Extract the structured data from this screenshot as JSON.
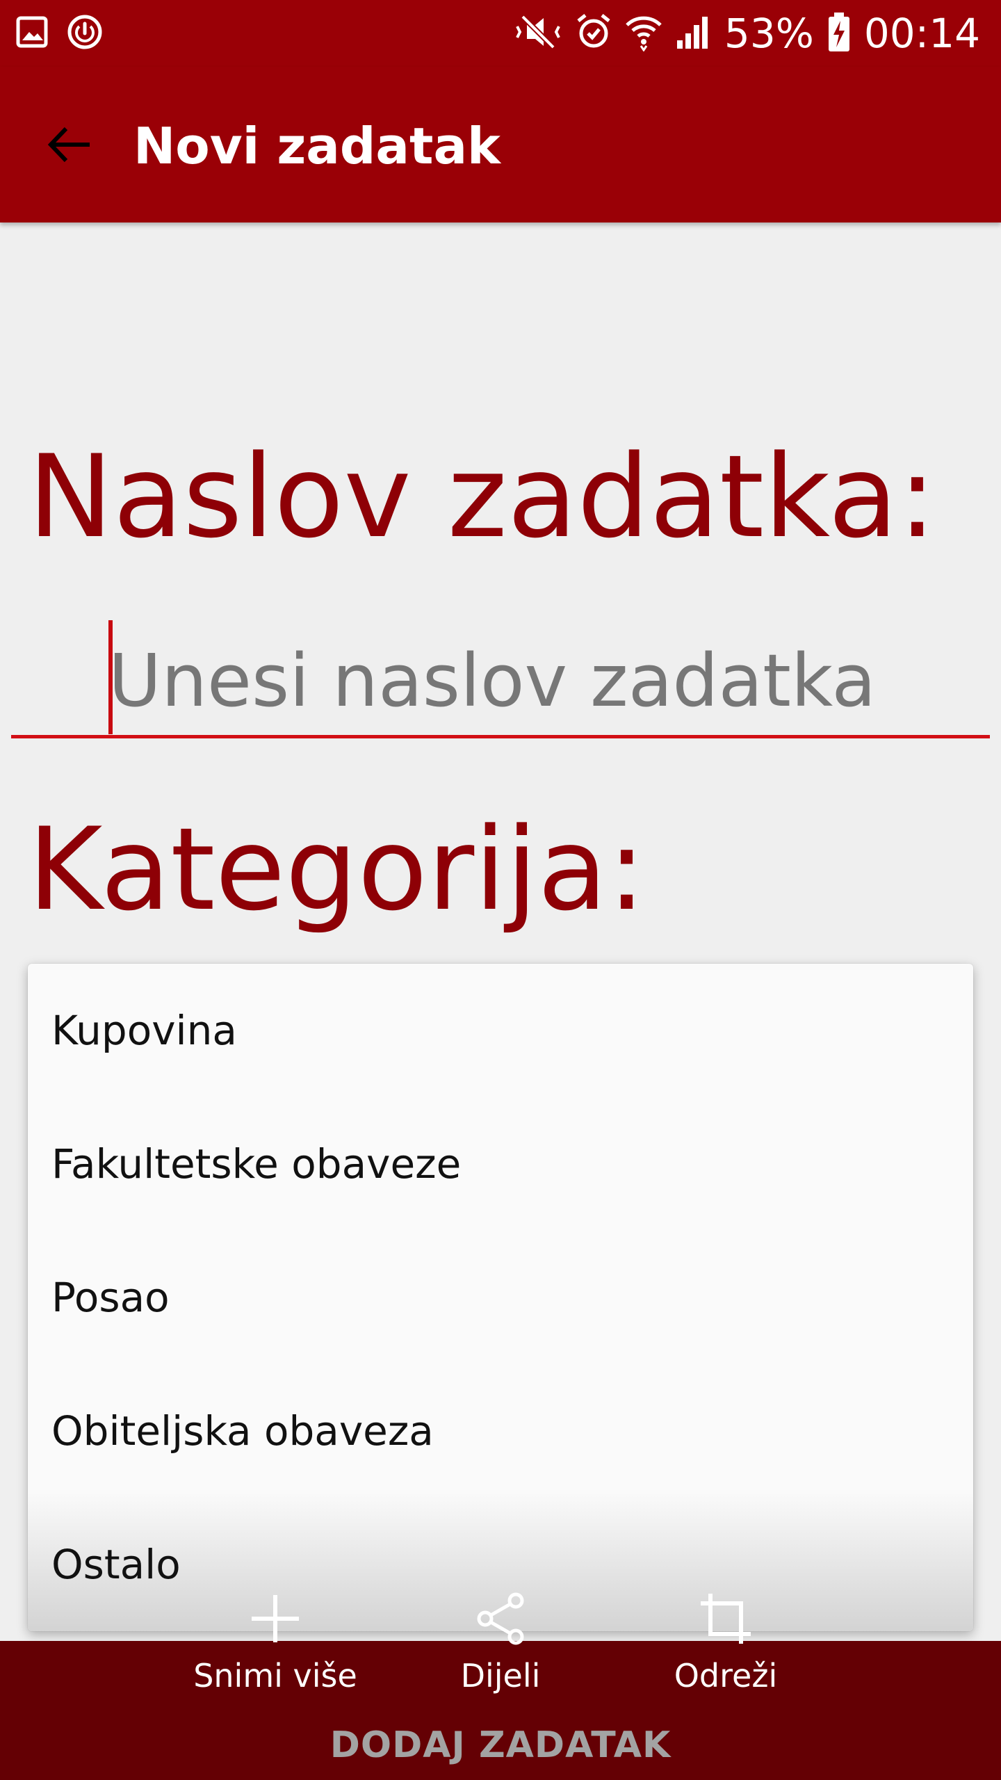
{
  "status_bar": {
    "battery_percent": "53%",
    "time": "00:14",
    "left_icons": [
      "gallery-icon",
      "power-icon"
    ],
    "right_icons": [
      "mute-icon",
      "alarm-icon",
      "wifi-icon",
      "signal-icon",
      "battery-charging-icon"
    ]
  },
  "app_bar": {
    "title": "Novi zadatak",
    "back_icon": "arrow-left-icon"
  },
  "form": {
    "title_label": "Naslov zadatka:",
    "title_placeholder": "Unesi naslov zadatka",
    "category_label": "Kategorija:"
  },
  "category_dropdown": {
    "options": [
      {
        "label": "Kupovina"
      },
      {
        "label": "Fakultetske obaveze"
      },
      {
        "label": "Posao"
      },
      {
        "label": "Obiteljska obaveza"
      },
      {
        "label": "Ostalo"
      }
    ]
  },
  "bottom": {
    "add_task_label": "DODAJ ZADATAK"
  },
  "screenshot_toolbar": {
    "items": [
      {
        "label": "Snimi više",
        "icon": "plus-icon"
      },
      {
        "label": "Dijeli",
        "icon": "share-icon"
      },
      {
        "label": "Odreži",
        "icon": "crop-icon"
      }
    ]
  },
  "colors": {
    "primary": "#9a0006",
    "primary_dark": "#640004",
    "accent": "#d20f16",
    "label_text": "#8e0006",
    "background": "#efefef"
  }
}
